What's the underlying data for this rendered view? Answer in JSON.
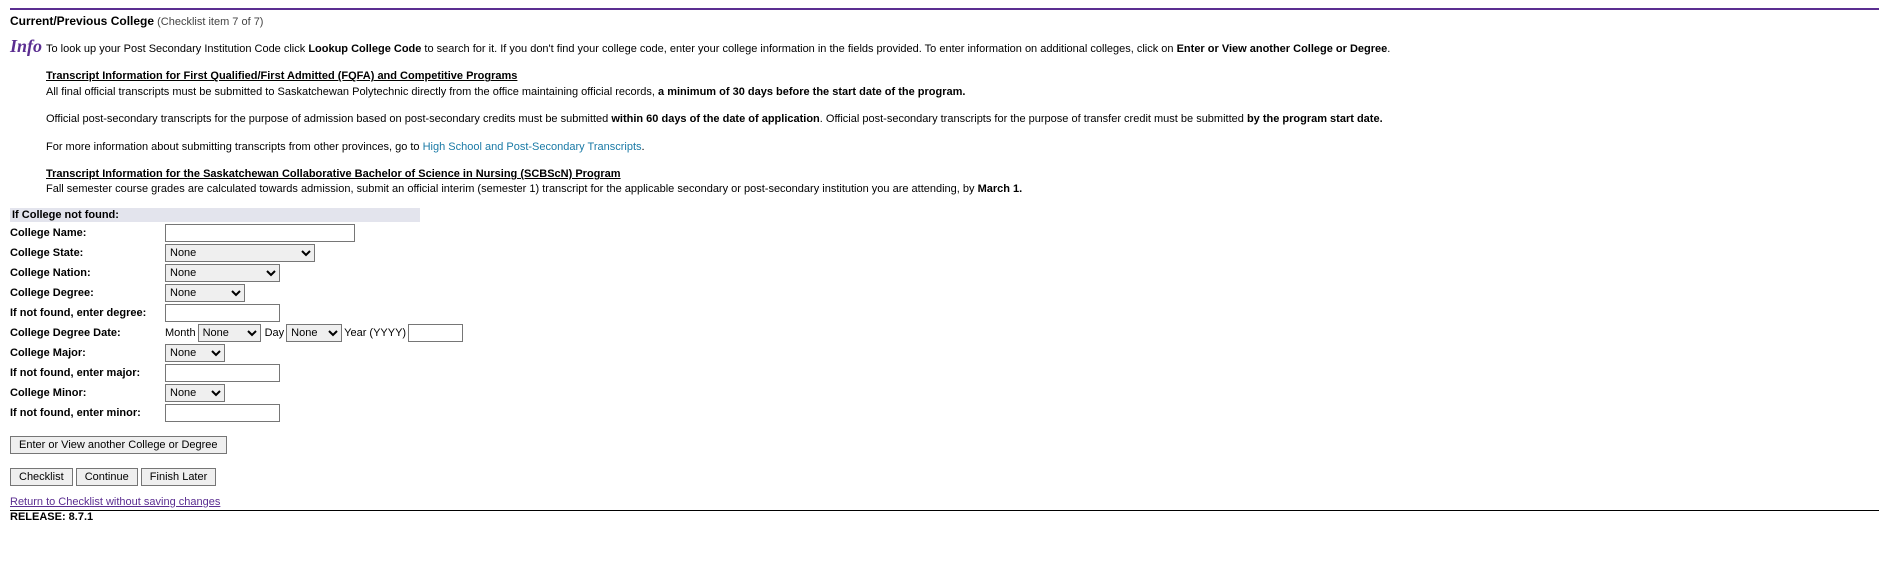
{
  "header": {
    "title": "Current/Previous College",
    "subtitle": "(Checklist item 7 of 7)"
  },
  "info": {
    "icon_text": "Info",
    "line1_a": "To look up your Post Secondary Institution Code click ",
    "line1_b": "Lookup College Code",
    "line1_c": " to search for it. If you don't find your college code, enter your college information in the fields provided. To enter information on additional colleges, click on ",
    "line1_d": "Enter or View another College or Degree",
    "line1_e": ".",
    "h1": "Transcript Information for First Qualified/First Admitted (FQFA) and Competitive Programs",
    "p1_a": "All final official transcripts must be submitted to Saskatchewan Polytechnic directly from the office maintaining official records, ",
    "p1_b": "a minimum of 30 days before the start date of the program.",
    "p2_a": "Official post-secondary transcripts for the purpose of admission based on post-secondary credits must be submitted ",
    "p2_b": "within 60 days of the date of application",
    "p2_c": ". Official post-secondary transcripts for the purpose of transfer credit must be submitted ",
    "p2_d": "by the program start date.",
    "p3_a": "For more information about submitting transcripts from other provinces, go to ",
    "p3_link": "High School and Post-Secondary Transcripts",
    "p3_b": ".",
    "h2": "Transcript Information for the Saskatchewan Collaborative Bachelor of Science in Nursing (SCBScN) Program",
    "p4_a": "Fall semester course grades are calculated towards admission, submit an official interim (semester 1) transcript for the applicable secondary or post-secondary institution you are attending, by ",
    "p4_b": "March 1."
  },
  "form": {
    "notfound_header": "If College not found:",
    "labels": {
      "name": "College Name:",
      "state": "College State:",
      "nation": "College Nation:",
      "degree": "College Degree:",
      "degree_nf": "If not found, enter degree:",
      "degree_date": "College Degree Date:",
      "month": "Month",
      "day": "Day",
      "year_hint": "Year (YYYY)",
      "major": "College Major:",
      "major_nf": "If not found, enter major:",
      "minor": "College Minor:",
      "minor_nf": "If not found, enter minor:"
    },
    "selects": {
      "state": "None",
      "nation": "None",
      "degree": "None",
      "month": "None",
      "day": "None",
      "major": "None",
      "minor": "None"
    }
  },
  "buttons": {
    "another": "Enter or View another College or Degree",
    "checklist": "Checklist",
    "continue": "Continue",
    "finish": "Finish Later"
  },
  "footer": {
    "return_link": "Return to Checklist without saving changes",
    "release": "RELEASE: 8.7.1"
  }
}
